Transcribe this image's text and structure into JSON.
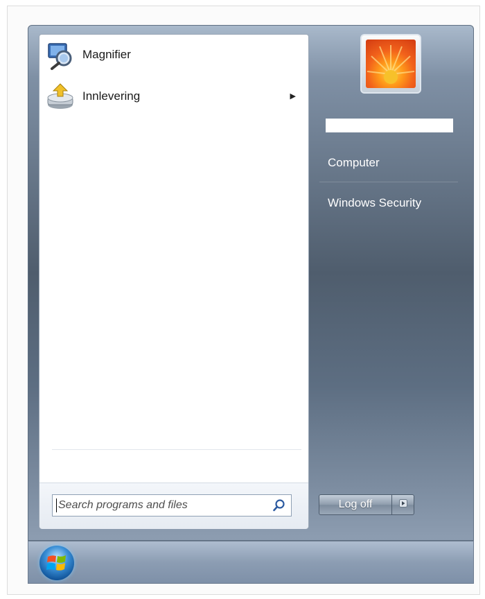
{
  "start_menu": {
    "programs": [
      {
        "label": "Magnifier",
        "icon": "magnifier-icon",
        "has_submenu": false
      },
      {
        "label": "Innlevering",
        "icon": "drive-upload-icon",
        "has_submenu": true
      }
    ],
    "search": {
      "placeholder": "Search programs and files",
      "icon": "search-icon"
    },
    "places": [
      {
        "label": "Computer"
      },
      {
        "label": "Windows Security"
      }
    ],
    "user": {
      "picture": "flower-picture"
    },
    "logoff": {
      "label": "Log off",
      "arrow_icon": "chevron-right-icon"
    }
  },
  "taskbar": {
    "start_button": "windows-orb-icon"
  },
  "colors": {
    "menu_dark": "#4f5d6d",
    "menu_light": "#a9b9cb",
    "taskbar": "#8c9db3",
    "left_panel": "#ffffff"
  }
}
